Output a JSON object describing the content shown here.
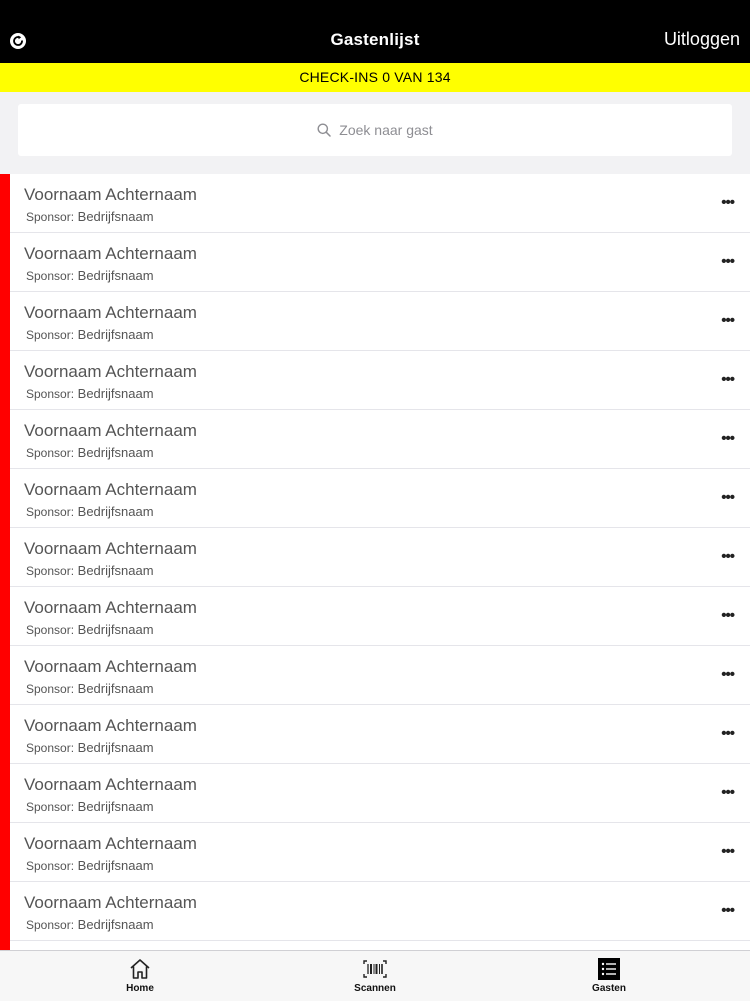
{
  "header": {
    "title": "Gastenlijst",
    "logout_label": "Uitloggen"
  },
  "banner": {
    "text": "CHECK-INS 0 VAN 134"
  },
  "search": {
    "placeholder": "Zoek naar gast"
  },
  "guests": [
    {
      "name": "Voornaam Achternaam",
      "sponsor_label": "Sponsor:",
      "company": "Bedrijfsnaam"
    },
    {
      "name": "Voornaam Achternaam",
      "sponsor_label": "Sponsor:",
      "company": "Bedrijfsnaam"
    },
    {
      "name": "Voornaam Achternaam",
      "sponsor_label": "Sponsor:",
      "company": "Bedrijfsnaam"
    },
    {
      "name": "Voornaam Achternaam",
      "sponsor_label": "Sponsor:",
      "company": "Bedrijfsnaam"
    },
    {
      "name": "Voornaam Achternaam",
      "sponsor_label": "Sponsor:",
      "company": "Bedrijfsnaam"
    },
    {
      "name": "Voornaam Achternaam",
      "sponsor_label": "Sponsor:",
      "company": "Bedrijfsnaam"
    },
    {
      "name": "Voornaam Achternaam",
      "sponsor_label": "Sponsor:",
      "company": "Bedrijfsnaam"
    },
    {
      "name": "Voornaam Achternaam",
      "sponsor_label": "Sponsor:",
      "company": "Bedrijfsnaam"
    },
    {
      "name": "Voornaam Achternaam",
      "sponsor_label": "Sponsor:",
      "company": "Bedrijfsnaam"
    },
    {
      "name": "Voornaam Achternaam",
      "sponsor_label": "Sponsor:",
      "company": "Bedrijfsnaam"
    },
    {
      "name": "Voornaam Achternaam",
      "sponsor_label": "Sponsor:",
      "company": "Bedrijfsnaam"
    },
    {
      "name": "Voornaam Achternaam",
      "sponsor_label": "Sponsor:",
      "company": "Bedrijfsnaam"
    },
    {
      "name": "Voornaam Achternaam",
      "sponsor_label": "Sponsor:",
      "company": "Bedrijfsnaam"
    }
  ],
  "row_menu_glyph": "•••",
  "tabs": [
    {
      "label": "Home",
      "icon": "home-icon"
    },
    {
      "label": "Scannen",
      "icon": "barcode-icon"
    },
    {
      "label": "Gasten",
      "icon": "list-icon"
    }
  ],
  "colors": {
    "header_bg": "#000000",
    "banner_bg": "#ffff00",
    "status_bar": "#ff0000"
  }
}
